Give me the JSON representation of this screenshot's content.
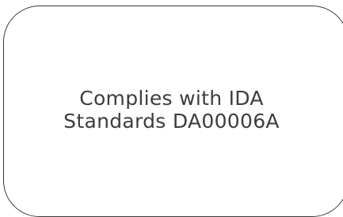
{
  "label": {
    "line1": "Complies with IDA",
    "line2": "Standards DA00006A"
  }
}
